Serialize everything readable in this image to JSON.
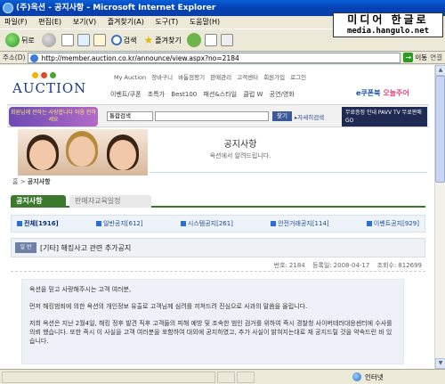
{
  "window": {
    "title": "(주)옥션 - 공지사항 - Microsoft Internet Explorer"
  },
  "watermark": {
    "korean": "미디어 한글로",
    "url": "media.hangulo.net"
  },
  "menu": [
    "파일(F)",
    "편집(E)",
    "보기(V)",
    "즐겨찾기(A)",
    "도구(T)",
    "도움말(H)"
  ],
  "toolbar": {
    "back": "뒤로",
    "search": "검색",
    "favorites": "즐겨찾기"
  },
  "address": {
    "label": "주소(D)",
    "url": "http://member.auction.co.kr/announce/view.aspx?no=2184",
    "go": "이동",
    "links": "연결"
  },
  "site": {
    "logo": "AUCTION",
    "top_links": [
      "My Auction",
      "장바구니",
      "바툼점평기",
      "판매관리",
      "고객센터",
      "회원가입",
      "로그인"
    ],
    "categories": [
      "이벤트/쿠폰",
      "초특가",
      "Best100",
      "패션&스타일",
      "클럽 W",
      "공연/영화"
    ],
    "ecoupon": "e쿠폰북",
    "ecoupon_accent": "오늘주어",
    "promo": "회원님께 전하는 사랑합니다 마음 전하세요",
    "search_select": "통합검색",
    "search_button": "찾기",
    "detail_search": "▸자세히검색",
    "pavv": "무료증정 안내 PAVV TV 무료판매GO"
  },
  "page": {
    "title": "공지사항",
    "subtitle": "옥션에서 알려드립니다.",
    "breadcrumb_home": "홈",
    "breadcrumb_sep": ">",
    "breadcrumb_current": "공지사항"
  },
  "tabs": {
    "active": "공지사항",
    "inactive": "판매자교육일정"
  },
  "filters": [
    "전체[1916]",
    "일반공지[612]",
    "시스템공지[261]",
    "안전거래공지[114]",
    "이벤트공지[929]"
  ],
  "notice": {
    "badge": "일 반",
    "title": "[기타] 해킹사고 관련 추가공지",
    "number_label": "번호:",
    "number": "2184",
    "date_label": "등록일:",
    "date": "2008-04-17",
    "views_label": "조회수:",
    "views": "812699",
    "paragraphs": [
      "옥션을 믿고 사랑해주시는 고객 여러분,",
      "먼저 해킹범죄에 의한 옥션의 개인정보 유출로 고객님께 심려를 끼쳐드려 진심으로 사과의 말씀을 올립니다.",
      "저희 옥션은 지난 2월4일, 해킹 정후 발견 직후 고객들의 피해 예방 및 조속한 범인 검거를 위하여 즉시 경찰청 사이버테러대응센터에 수사를 의뢰 했습니다. 또한 즉시 이 사실을 고객 여러분을 포함하여 대외에 공지하였고, 추가 사실이 밝혀지는대로 재 공지드릴 것을 약속드린 바 있습니다."
    ]
  },
  "status": {
    "zone": "인터넷"
  },
  "colors": {
    "accent_green": "#3b7a2c",
    "title_blue": "#0442b4"
  }
}
